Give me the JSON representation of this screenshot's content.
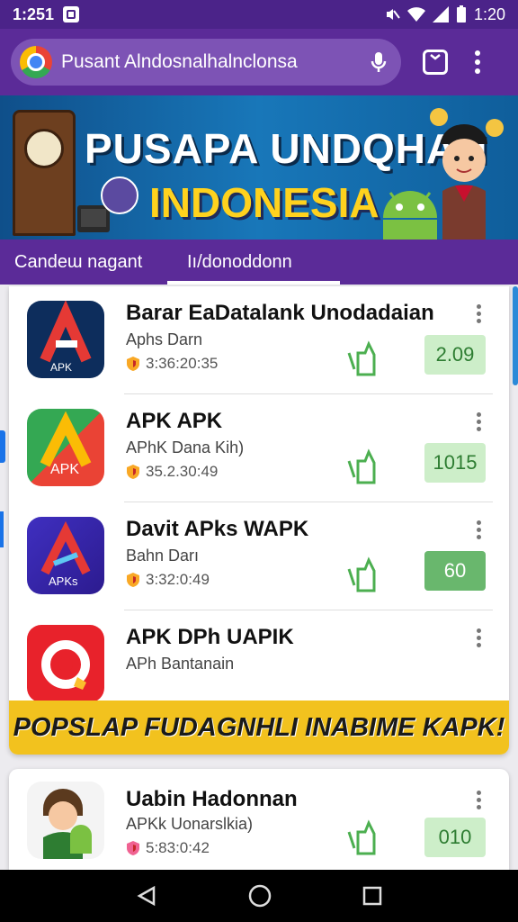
{
  "status_bar": {
    "time": "1:251",
    "clock": "1:20"
  },
  "browser": {
    "url": "Pusant Alndosnalhalnclonsa"
  },
  "banner": {
    "line1": "PUSAPA UNDQHAN",
    "line2": "INDONESIA"
  },
  "tabs": [
    {
      "label": "Candeɯ nagant"
    },
    {
      "label": "Iı/donoddonn"
    }
  ],
  "apps": [
    {
      "name": "Barar EaDatalank Unodadaian",
      "sub": "Aphs Darn",
      "meta": "3:36:20:35",
      "price": "2.09",
      "price_style": "light"
    },
    {
      "name": "APK APK",
      "sub": "APhK Dana Kih)",
      "meta": "35.2.30:49",
      "price": "1015",
      "price_style": "light"
    },
    {
      "name": "Davit APks WAPK",
      "sub": "Bahn Darı",
      "meta": "3:32:0:49",
      "price": "60",
      "price_style": "dark"
    },
    {
      "name": "APK DPh UAPIK",
      "sub": "APh Bantanain",
      "meta": "",
      "price": "",
      "price_style": "none"
    }
  ],
  "promo": {
    "text": "POPSLAP FUDAGNHLI INABIME KAPK!"
  },
  "app_bottom": {
    "name": "Uabin Hadonnan",
    "sub": "APKk Uonarslkia)",
    "meta": "5:83:0:42",
    "price": "010"
  },
  "colors": {
    "header": "#5b2b98",
    "status": "#4b2389",
    "price_light": "#cdeec9",
    "price_dark": "#69b76d",
    "promo": "#f2c21e"
  }
}
